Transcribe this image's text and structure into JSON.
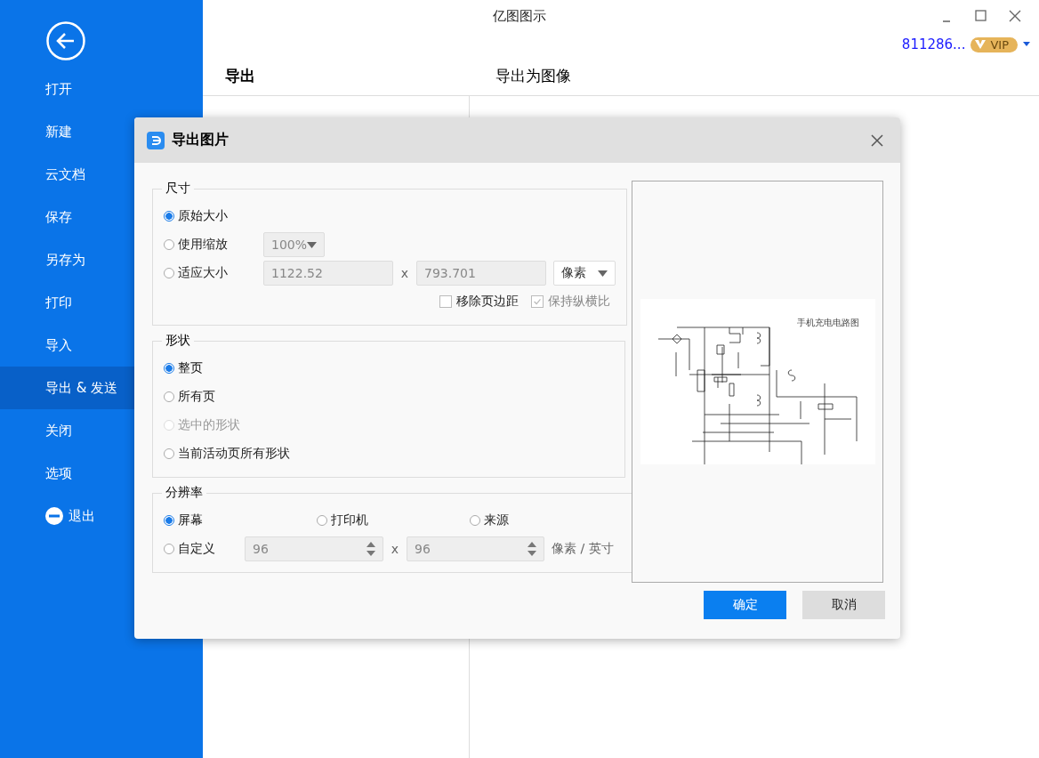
{
  "window": {
    "title": "亿图图示"
  },
  "account": {
    "user": "811286...",
    "badge": "VIP"
  },
  "sidebar": {
    "items": [
      {
        "label": "打开",
        "selected": false,
        "kind": "plain"
      },
      {
        "label": "新建",
        "selected": false,
        "kind": "plain"
      },
      {
        "label": "云文档",
        "selected": false,
        "kind": "plain"
      },
      {
        "label": "保存",
        "selected": false,
        "kind": "plain"
      },
      {
        "label": "另存为",
        "selected": false,
        "kind": "plain"
      },
      {
        "label": "打印",
        "selected": false,
        "kind": "plain"
      },
      {
        "label": "导入",
        "selected": false,
        "kind": "plain"
      },
      {
        "label": "导出 & 发送",
        "selected": true,
        "kind": "plain"
      },
      {
        "label": "关闭",
        "selected": false,
        "kind": "plain"
      },
      {
        "label": "选项",
        "selected": false,
        "kind": "plain"
      },
      {
        "label": "退出",
        "selected": false,
        "kind": "exit"
      }
    ]
  },
  "page": {
    "left_title": "导出",
    "right_title": "导出为图像"
  },
  "dialog": {
    "title": "导出图片",
    "size": {
      "legend": "尺寸",
      "options": [
        {
          "label": "原始大小",
          "selected": true
        },
        {
          "label": "使用缩放",
          "selected": false
        },
        {
          "label": "适应大小",
          "selected": false
        }
      ],
      "zoom": {
        "value": "100%",
        "disabled": true
      },
      "width": {
        "value": "1122.52",
        "disabled": true
      },
      "separator": "x",
      "height": {
        "value": "793.701",
        "disabled": true
      },
      "unit": {
        "value": "像素",
        "disabled": false
      },
      "remove_margin": {
        "label": "移除页边距",
        "checked": false,
        "disabled": false
      },
      "keep_ratio": {
        "label": "保持纵横比",
        "checked": true,
        "disabled": true
      }
    },
    "shape": {
      "legend": "形状",
      "options": [
        {
          "label": "整页",
          "selected": true,
          "disabled": false
        },
        {
          "label": "所有页",
          "selected": false,
          "disabled": false
        },
        {
          "label": "选中的形状",
          "selected": false,
          "disabled": true
        },
        {
          "label": "当前活动页所有形状",
          "selected": false,
          "disabled": false
        }
      ]
    },
    "resolution": {
      "legend": "分辨率",
      "options": [
        {
          "label": "屏幕",
          "selected": true
        },
        {
          "label": "打印机",
          "selected": false
        },
        {
          "label": "来源",
          "selected": false
        },
        {
          "label": "自定义",
          "selected": false
        }
      ],
      "dpi_x": {
        "value": "96",
        "disabled": true
      },
      "separator": "x",
      "dpi_y": {
        "value": "96",
        "disabled": true
      },
      "unit": "像素 / 英寸"
    },
    "preview": {
      "title": "手机充电电路图"
    },
    "buttons": [
      {
        "label": "确定",
        "kind": "primary"
      },
      {
        "label": "取消",
        "kind": "secondary"
      }
    ]
  }
}
